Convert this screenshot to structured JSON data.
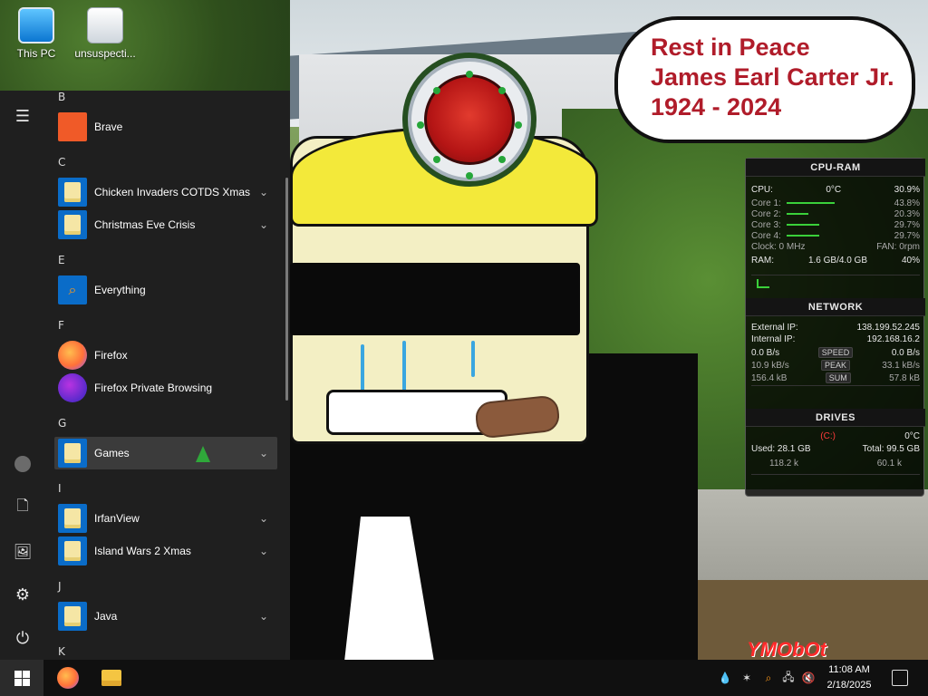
{
  "desktop": {
    "icons": [
      {
        "name": "this-pc",
        "label": "This PC"
      },
      {
        "name": "unsuspecting-file",
        "label": "unsuspecti..."
      }
    ],
    "speech_bubble": {
      "line1": "Rest in Peace",
      "line2": "James Earl Carter Jr.",
      "line3": "1924 - 2024"
    },
    "watermark": "YMObOt"
  },
  "start_menu": {
    "sections": [
      {
        "letter": "B",
        "apps": [
          {
            "label": "Brave",
            "has_chevron": false,
            "icon": "brave-icon"
          }
        ]
      },
      {
        "letter": "C",
        "apps": [
          {
            "label": "Chicken Invaders COTDS Xmas",
            "has_chevron": true,
            "icon": "folder-icon"
          },
          {
            "label": "Christmas Eve Crisis",
            "has_chevron": true,
            "icon": "folder-icon"
          }
        ]
      },
      {
        "letter": "E",
        "apps": [
          {
            "label": "Everything",
            "has_chevron": false,
            "icon": "everything-search-icon"
          }
        ]
      },
      {
        "letter": "F",
        "apps": [
          {
            "label": "Firefox",
            "has_chevron": false,
            "icon": "firefox-icon"
          },
          {
            "label": "Firefox Private Browsing",
            "has_chevron": false,
            "icon": "firefox-private-icon"
          }
        ]
      },
      {
        "letter": "G",
        "apps": [
          {
            "label": "Games",
            "has_chevron": true,
            "icon": "folder-icon",
            "selected": true
          }
        ]
      },
      {
        "letter": "I",
        "apps": [
          {
            "label": "IrfanView",
            "has_chevron": true,
            "icon": "folder-icon"
          },
          {
            "label": "Island Wars 2 Xmas",
            "has_chevron": true,
            "icon": "folder-icon"
          }
        ]
      },
      {
        "letter": "J",
        "apps": [
          {
            "label": "Java",
            "has_chevron": true,
            "icon": "folder-icon"
          }
        ]
      },
      {
        "letter": "K",
        "apps": []
      }
    ],
    "rail": [
      {
        "name": "hamburger",
        "icon": "hamburger-icon"
      },
      {
        "name": "account",
        "icon": "user-icon"
      },
      {
        "name": "documents",
        "icon": "document-icon"
      },
      {
        "name": "pictures",
        "icon": "image-icon"
      },
      {
        "name": "settings",
        "icon": "gear-icon"
      },
      {
        "name": "power",
        "icon": "power-icon"
      }
    ],
    "chevron_glyph": "⌄"
  },
  "meters": {
    "cpu": {
      "title": "CPU-RAM",
      "cpu_label": "CPU:",
      "temp": "0°C",
      "cpu_pct": "30.9%",
      "cores": [
        {
          "label": "Core 1:",
          "value": "43.8%",
          "level": 0.438
        },
        {
          "label": "Core 2:",
          "value": "20.3%",
          "level": 0.203
        },
        {
          "label": "Core 3:",
          "value": "29.7%",
          "level": 0.297
        },
        {
          "label": "Core 4:",
          "value": "29.7%",
          "level": 0.297
        }
      ],
      "clock": "Clock: 0 MHz",
      "fan": "FAN: 0rpm",
      "ram_label": "RAM:",
      "ram_used": "1.6 GB/4.0 GB",
      "ram_pct": "40%"
    },
    "network": {
      "title": "NETWORK",
      "external_label": "External IP:",
      "external_ip": "138.199.52.245",
      "internal_label": "Internal IP:",
      "internal_ip": "192.168.16.2",
      "speed_left": "0.0 B/s",
      "speed_tag": "SPEED",
      "speed_right": "0.0 B/s",
      "peak_left": "10.9 kB/s",
      "peak_tag": "PEAK",
      "peak_right": "33.1 kB/s",
      "sum_left": "156.4 kB",
      "sum_tag": "SUM",
      "sum_right": "57.8 kB"
    },
    "drives": {
      "title": "DRIVES",
      "drive": "(C:)",
      "temp": "0°C",
      "used": "Used: 28.1 GB",
      "total": "Total: 99.5 GB",
      "read": "118.2 k",
      "write": "60.1 k"
    }
  },
  "taskbar": {
    "time": "11:08 AM",
    "date": "2/18/2025",
    "pinned": [
      {
        "name": "firefox",
        "icon": "firefox-icon"
      },
      {
        "name": "file-explorer",
        "icon": "folder-icon"
      }
    ]
  },
  "colors": {
    "start_bg": "#1f1f1f",
    "accent": "#0a6cc8",
    "bubble_text": "#b01c2a",
    "taskbar": "#101010"
  }
}
